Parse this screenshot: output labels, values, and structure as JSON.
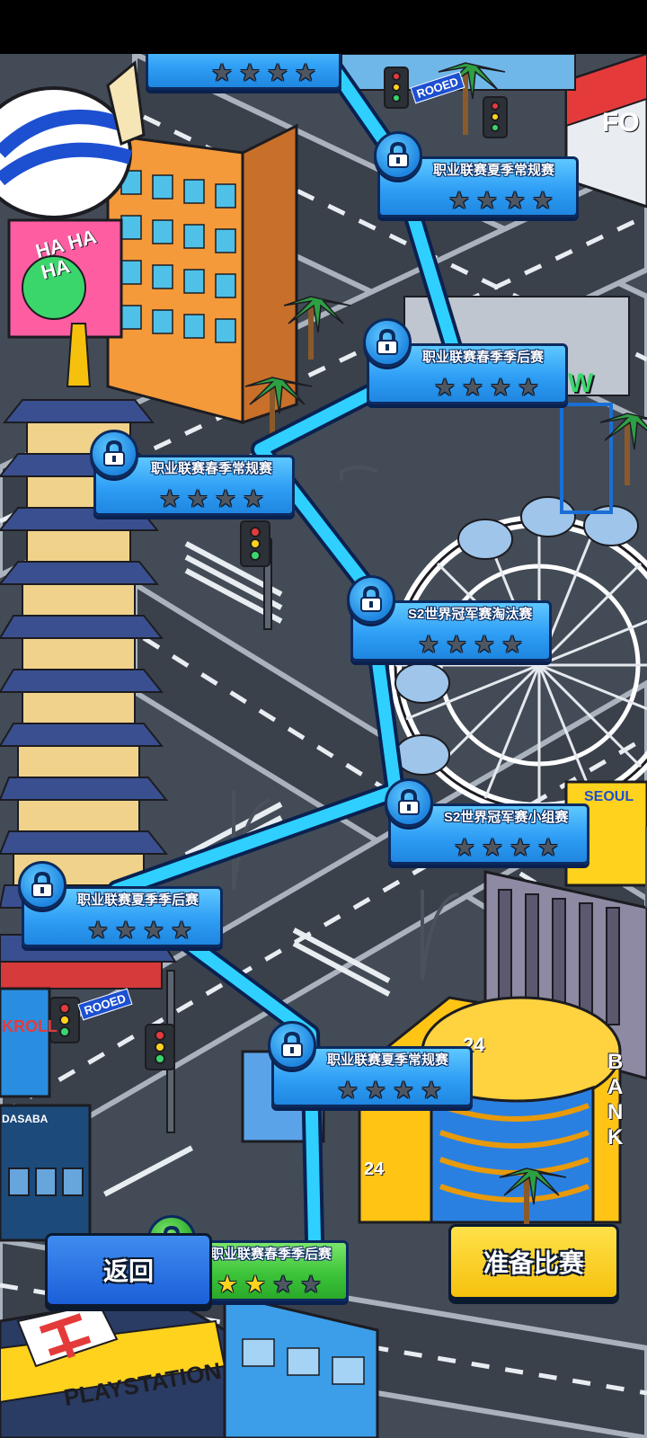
{
  "nodes": [
    {
      "id": "top",
      "label": "",
      "stars": [
        false,
        false,
        false,
        false
      ],
      "state": "locked"
    },
    {
      "id": "n1",
      "label": "职业联赛夏季常规赛",
      "stars": [
        false,
        false,
        false,
        false
      ],
      "state": "locked"
    },
    {
      "id": "n2",
      "label": "职业联赛春季季后赛",
      "stars": [
        false,
        false,
        false,
        false
      ],
      "state": "locked"
    },
    {
      "id": "n3",
      "label": "职业联赛春季常规赛",
      "stars": [
        false,
        false,
        false,
        false
      ],
      "state": "locked"
    },
    {
      "id": "n4",
      "label": "S2世界冠军赛淘汰赛",
      "stars": [
        false,
        false,
        false,
        false
      ],
      "state": "locked"
    },
    {
      "id": "n5",
      "label": "S2世界冠军赛小组赛",
      "stars": [
        false,
        false,
        false,
        false
      ],
      "state": "locked"
    },
    {
      "id": "n6",
      "label": "职业联赛夏季季后赛",
      "stars": [
        false,
        false,
        false,
        false
      ],
      "state": "locked"
    },
    {
      "id": "n7",
      "label": "职业联赛夏季常规赛",
      "stars": [
        false,
        false,
        false,
        false
      ],
      "state": "locked"
    },
    {
      "id": "n8",
      "label": "职业联赛春季季后赛",
      "stars": [
        true,
        true,
        false,
        false
      ],
      "state": "completed"
    }
  ],
  "buttons": {
    "back": "返回",
    "ready": "准备比赛"
  },
  "signs": {
    "ha": "HA HA HA",
    "rooed": "ROOED",
    "bank": "BANK",
    "playstation": "PLAYSTATION",
    "fo": "FO",
    "num24": "24",
    "seoul": "SEOUL",
    "kroll": "KROLL",
    "dasaba": "DASABA",
    "w": "W"
  },
  "colors": {
    "path": "#2fd0ff",
    "panel": "#2f9ef5",
    "completed": "#3dc43a",
    "star_on": "#ffd21e",
    "star_off": "#4e5661"
  }
}
